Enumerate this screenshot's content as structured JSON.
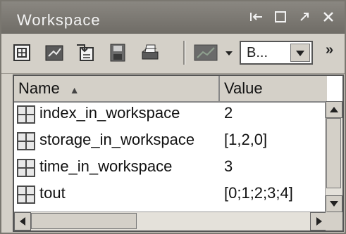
{
  "window": {
    "title": "Workspace",
    "controls": {
      "undock_icon": "undock-icon",
      "maximize_icon": "maximize-icon",
      "restore_icon": "arrow-out-icon",
      "close_icon": "close-icon"
    }
  },
  "toolbar": {
    "buttons": [
      {
        "icon": "new-variable-icon"
      },
      {
        "icon": "open-variable-icon"
      },
      {
        "icon": "import-data-icon"
      },
      {
        "icon": "save-icon"
      },
      {
        "icon": "print-icon"
      },
      {
        "icon": "plot-icon"
      }
    ],
    "combo": {
      "value": "B..."
    },
    "overflow_label": "»"
  },
  "table": {
    "columns": [
      "Name",
      "Value"
    ],
    "sort_indicator": "▲",
    "rows": [
      {
        "name": "index_in_workspace",
        "value": "2"
      },
      {
        "name": "storage_in_workspace",
        "value": "[1,2,0]"
      },
      {
        "name": "time_in_workspace",
        "value": "3"
      },
      {
        "name": "tout",
        "value": "[0;1;2;3;4]"
      }
    ]
  },
  "colors": {
    "titlebar": "#6f6c66",
    "chrome": "#d4d0c8",
    "table_bg": "#ffffff"
  }
}
